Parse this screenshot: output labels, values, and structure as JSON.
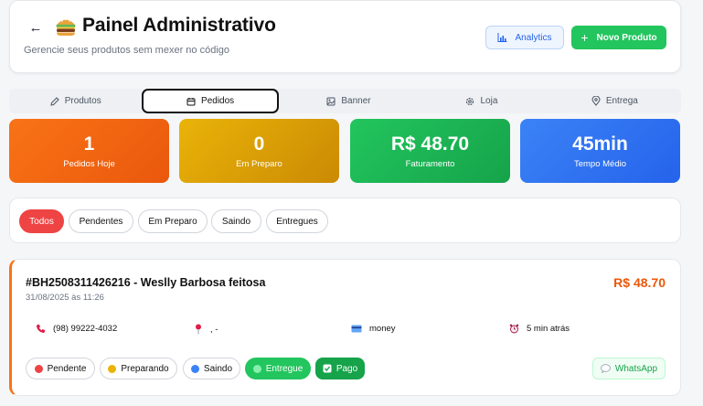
{
  "header": {
    "back_icon": "arrow-left-icon",
    "title_icon": "hamburger-icon",
    "title": "Painel Administrativo",
    "subtitle": "Gerencie seus produtos sem mexer no código",
    "analytics_label": "Analytics",
    "novo_produto_label": "Novo Produto"
  },
  "tabs": [
    {
      "label": "Produtos",
      "icon": "pencil-icon"
    },
    {
      "label": "Pedidos",
      "icon": "calendar-icon",
      "active": true
    },
    {
      "label": "Banner",
      "icon": "image-icon"
    },
    {
      "label": "Loja",
      "icon": "gear-icon"
    },
    {
      "label": "Entrega",
      "icon": "map-pin-icon"
    }
  ],
  "stats": [
    {
      "value": "1",
      "label": "Pedidos Hoje",
      "color": "#f97316"
    },
    {
      "value": "0",
      "label": "Em Preparo",
      "color": "#eab308"
    },
    {
      "value": "R$ 48.70",
      "label": "Faturamento",
      "color": "#22c55e"
    },
    {
      "value": "45min",
      "label": "Tempo Médio",
      "color": "#3b82f6"
    }
  ],
  "filters": [
    {
      "label": "Todos",
      "active": true
    },
    {
      "label": "Pendentes"
    },
    {
      "label": "Em Preparo"
    },
    {
      "label": "Saindo"
    },
    {
      "label": "Entregues"
    }
  ],
  "order": {
    "title": "#BH2508311426216 - Weslly Barbosa feitosa",
    "date": "31/08/2025 às 11:26",
    "total": "R$ 48.70",
    "phone": "(98) 99222-4032",
    "address": ", -",
    "payment": "money",
    "time_ago": "5 min atrás",
    "status_buttons": [
      {
        "label": "Pendente",
        "dot": "#ef4444"
      },
      {
        "label": "Preparando",
        "dot": "#eab308"
      },
      {
        "label": "Saindo",
        "dot": "#3b82f6"
      },
      {
        "label": "Entregue",
        "dot": "#86efac"
      },
      {
        "label": "Pago",
        "icon": "check-box-icon"
      }
    ],
    "whatsapp_label": "WhatsApp"
  },
  "colors": {
    "accent_orange": "#ea580c",
    "filter_active": "#ef4444",
    "primary_green": "#22c55e"
  }
}
